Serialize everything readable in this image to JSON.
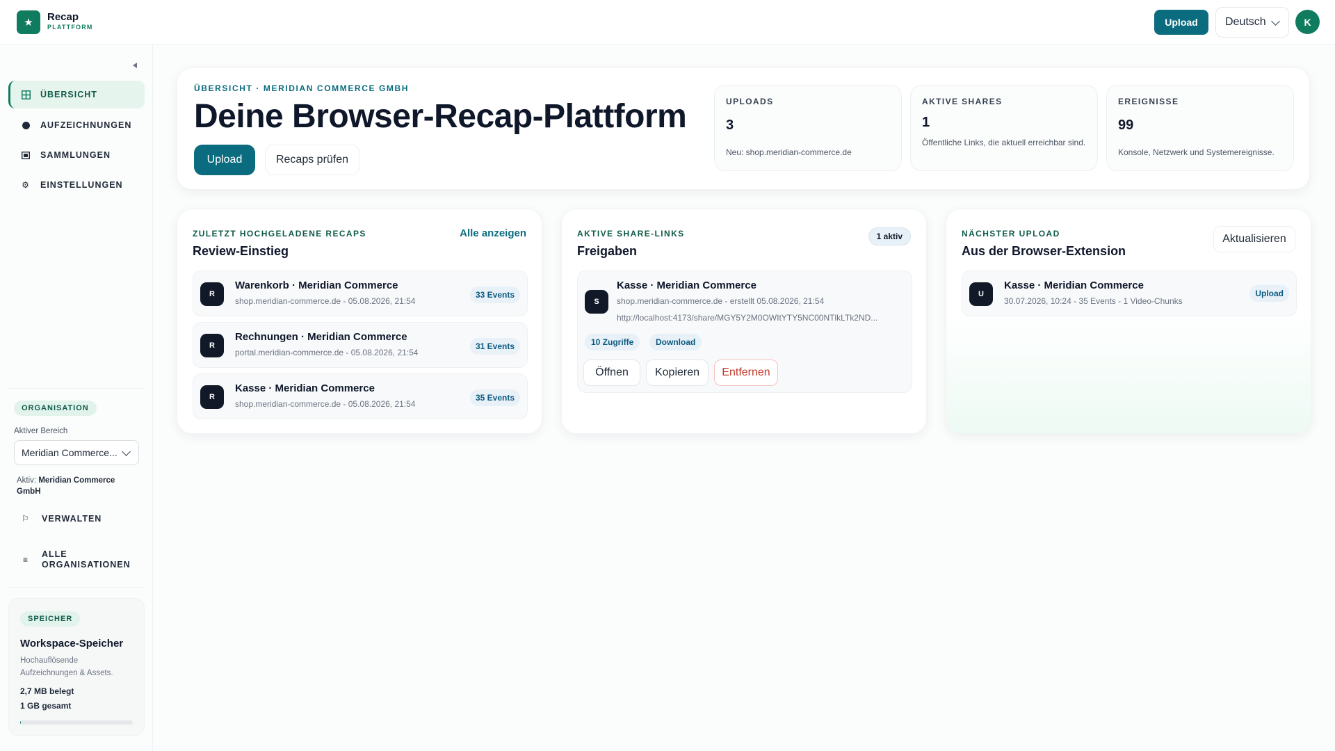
{
  "app": {
    "title": "Recap",
    "subtitle": "PLATTFORM",
    "logo_icon": "star-icon",
    "brand_color": "#0f7b5f",
    "accent_color": "#0c6c7f"
  },
  "topbar": {
    "upload_label": "Upload",
    "language": "Deutsch",
    "avatar_initial": "K"
  },
  "sidebar": {
    "items": [
      {
        "label": "ÜBERSICHT",
        "icon": "grid-icon",
        "active": true
      },
      {
        "label": "AUFZEICHNUNGEN",
        "icon": "record-dot-icon",
        "active": false
      },
      {
        "label": "SAMMLUNGEN",
        "icon": "collection-icon",
        "active": false
      },
      {
        "label": "EINSTELLUNGEN",
        "icon": "gear-icon",
        "active": false
      }
    ],
    "org": {
      "pill": "ORGANISATION",
      "label": "Aktiver Bereich",
      "selected": "Meridian Commerce...",
      "active_prefix": "Aktiv:",
      "active_name": "Meridian Commerce GmbH",
      "manage_label": "VERWALTEN",
      "all_label_1": "ALLE",
      "all_label_2": "ORGANISATIONEN"
    },
    "storage": {
      "pill": "SPEICHER",
      "title": "Workspace-Speicher",
      "desc": "Hochauflösende Aufzeichnungen & Assets.",
      "used": "2,7 MB belegt",
      "total": "1 GB gesamt",
      "used_fraction": 0.0027
    }
  },
  "hero": {
    "eyebrow": "ÜBERSICHT · MERIDIAN COMMERCE GMBH",
    "title": "Deine Browser-Recap-Plattform",
    "upload_label": "Upload",
    "review_label": "Recaps prüfen",
    "stats": [
      {
        "label": "UPLOADS",
        "value": "3",
        "desc": "Neu: shop.meridian-commerce.de"
      },
      {
        "label": "AKTIVE SHARES",
        "value": "1",
        "desc": "Öffentliche Links, die aktuell erreichbar sind."
      },
      {
        "label": "EREIGNISSE",
        "value": "99",
        "desc": "Konsole, Netzwerk und Systemereignisse."
      }
    ]
  },
  "recent": {
    "eyebrow": "ZULETZT HOCHGELADENE RECAPS",
    "title": "Review-Einstieg",
    "link": "Alle anzeigen",
    "items": [
      {
        "initial": "R",
        "title": "Warenkorb · Meridian Commerce",
        "sub": "shop.meridian-commerce.de - 05.08.2026, 21:54",
        "events": "33 Events"
      },
      {
        "initial": "R",
        "title": "Rechnungen · Meridian Commerce",
        "sub": "portal.meridian-commerce.de - 05.08.2026, 21:54",
        "events": "31 Events"
      },
      {
        "initial": "R",
        "title": "Kasse · Meridian Commerce",
        "sub": "shop.meridian-commerce.de - 05.08.2026, 21:54",
        "events": "35 Events"
      }
    ]
  },
  "shares": {
    "eyebrow": "AKTIVE SHARE-LINKS",
    "title": "Freigaben",
    "badge": "1 aktiv",
    "item": {
      "initial": "S",
      "title": "Kasse · Meridian Commerce",
      "sub": "shop.meridian-commerce.de - erstellt 05.08.2026, 21:54",
      "url": "http://localhost:4173/share/MGY5Y2M0OWItYTY5NC00NTlkLTk2ND...",
      "chip_views": "10 Zugriffe",
      "chip_download": "Download",
      "open_label": "Öffnen",
      "copy_label": "Kopieren",
      "remove_label": "Entfernen"
    }
  },
  "next_upload": {
    "eyebrow": "NÄCHSTER UPLOAD",
    "title": "Aus der Browser-Extension",
    "refresh_label": "Aktualisieren",
    "item": {
      "initial": "U",
      "title": "Kasse · Meridian Commerce",
      "sub": "30.07.2026, 10:24 - 35 Events - 1 Video-Chunks",
      "badge": "Upload"
    }
  }
}
